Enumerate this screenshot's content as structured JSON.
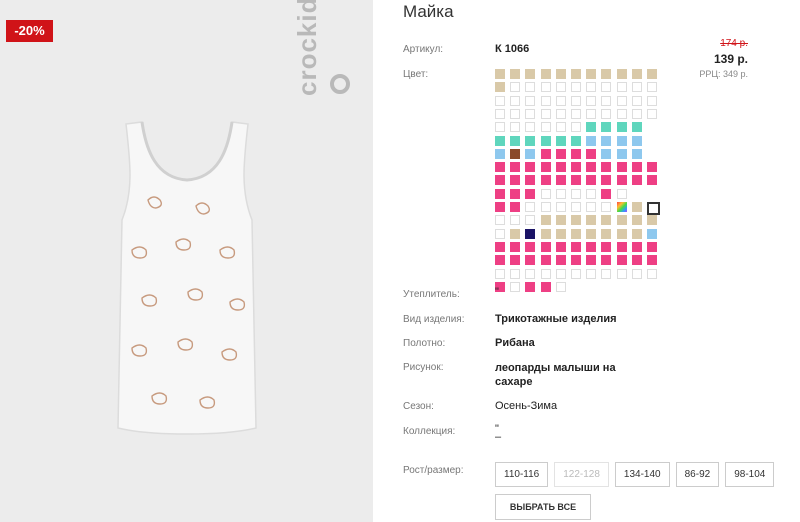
{
  "product": {
    "title": "Майка",
    "badge": "-20%",
    "brand": "crockid"
  },
  "price": {
    "old": "174 р.",
    "current": "139 р.",
    "rrp": "РРЦ: 349 р."
  },
  "details": {
    "article_label": "Артикул:",
    "article_value": "К 1066",
    "color_label": "Цвет:",
    "insulation_label": "Утеплитель:",
    "insulation_value": "\"",
    "type_label": "Вид изделия:",
    "type_value": "Трикотажные изделия",
    "fabric_label": "Полотно:",
    "fabric_value": "Рибана",
    "pattern_label": "Рисунок:",
    "pattern_value_1": "леопарды малыши на",
    "pattern_value_2": "сахаре",
    "season_label": "Сезон:",
    "season_value": "Осень-Зима",
    "collection_label": "Коллекция:",
    "collection_value_1": "\"",
    "collection_value_2": "–",
    "size_label": "Рост/размер:"
  },
  "colors": {
    "beige": "#d9c9a8",
    "white": "#ffffff",
    "teal": "#5fd6bd",
    "lightblue": "#8ec8ee",
    "brown": "#8a4a2a",
    "pink": "#ee3f84",
    "navy": "#1a1366",
    "accent_red": "#d01318"
  },
  "sizes": [
    {
      "label": "110-116",
      "disabled": false
    },
    {
      "label": "122-128",
      "disabled": true
    },
    {
      "label": "134-140",
      "disabled": false
    },
    {
      "label": "86-92",
      "disabled": false
    },
    {
      "label": "98-104",
      "disabled": false
    }
  ],
  "select_all_label": "ВЫБРАТЬ ВСЕ"
}
